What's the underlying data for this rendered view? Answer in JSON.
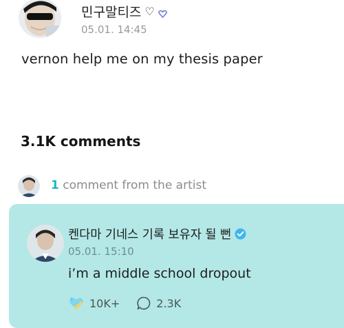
{
  "post": {
    "author": "민구말티즈",
    "heart_glyph": "♡",
    "time": "05.01. 14:45",
    "body": "vernon help me on my thesis paper"
  },
  "comments": {
    "count_label": "3.1K comments"
  },
  "artist_summary": {
    "count": "1",
    "label": " comment from the artist"
  },
  "artist_comment": {
    "author": "켄다마 기네스 기록 보유자 될 뻔",
    "time": "05.01. 15:10",
    "text": "i’m a middle school dropout",
    "likes": "10K+",
    "replies": "2.3K"
  },
  "colors": {
    "accent": "#1cb7c2",
    "artist_bg": "#b3e8e6",
    "verified_badge": "#3fb6ea"
  },
  "icons": {
    "verified": "verified-check-icon",
    "like": "sparkle-heart-icon",
    "reply": "speech-bubble-icon"
  }
}
